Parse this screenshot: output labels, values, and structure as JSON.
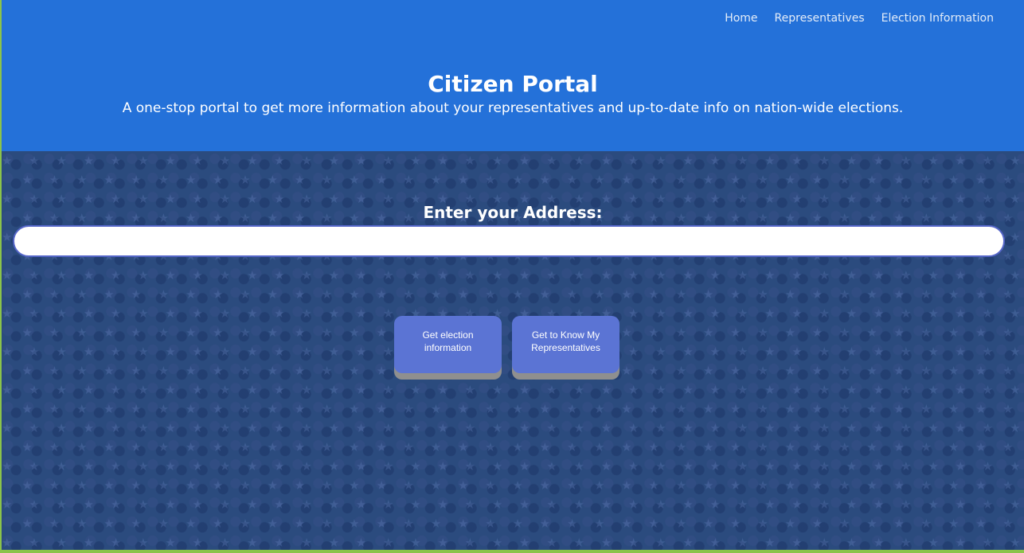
{
  "nav": {
    "items": [
      {
        "label": "Home"
      },
      {
        "label": "Representatives"
      },
      {
        "label": "Election Information"
      }
    ]
  },
  "header": {
    "title": "Citizen Portal",
    "subtitle": "A one-stop portal to get more information about your representatives and up-to-date info on nation-wide elections."
  },
  "form": {
    "address_label": "Enter your Address:",
    "address_value": "",
    "election_button": "Get election information",
    "reps_button": "Get to Know My Representatives"
  },
  "colors": {
    "header_bg": "#2471d9",
    "main_bg": "#2b4b7e",
    "button_bg": "#5b74d4",
    "button_shadow": "#8f8f8f",
    "page_border": "#8bc34a"
  }
}
